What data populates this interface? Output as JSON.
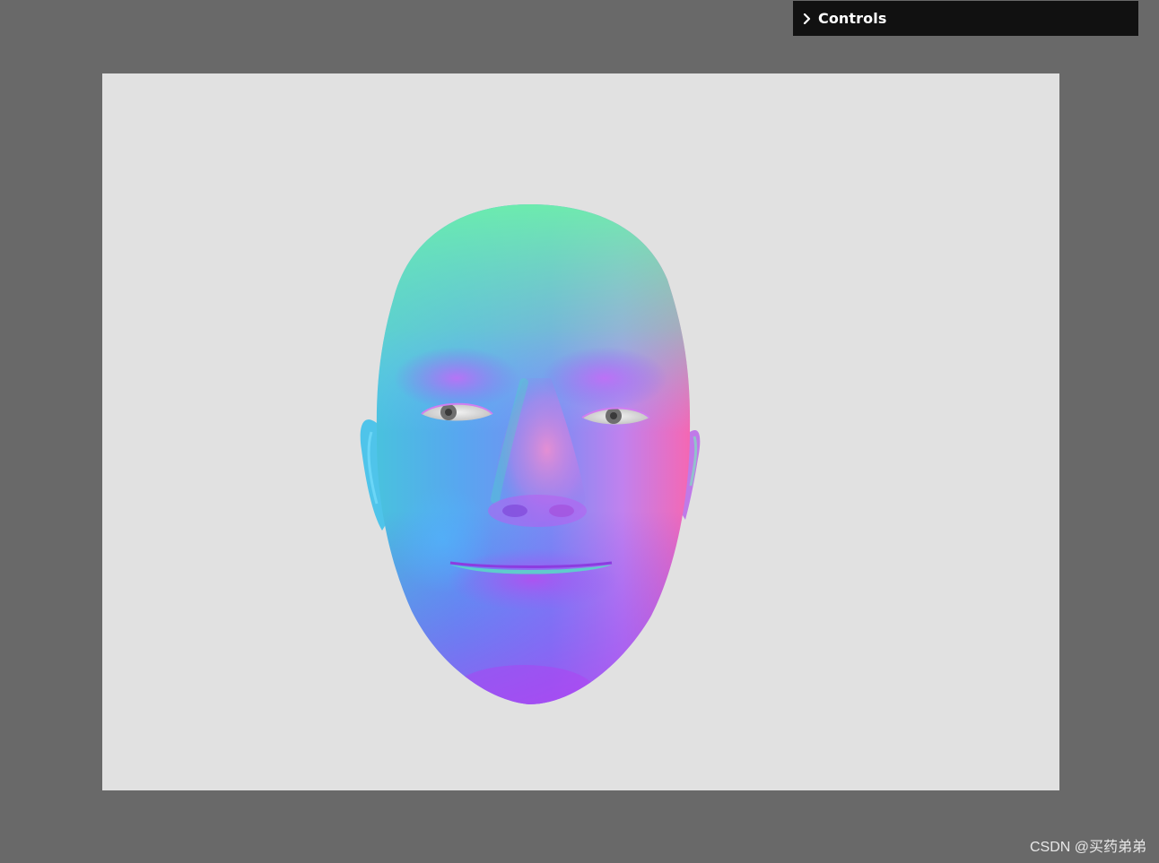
{
  "controls": {
    "label": "Controls",
    "chevron_icon": "chevron-right-icon"
  },
  "viewport": {
    "background_color": "#e1e1e1",
    "content": "3d-head-normal-material"
  },
  "colors": {
    "page_background": "#696969",
    "panel_background": "#111111",
    "panel_text": "#ffffff"
  },
  "watermark": {
    "text": "CSDN @买药弟弟"
  }
}
